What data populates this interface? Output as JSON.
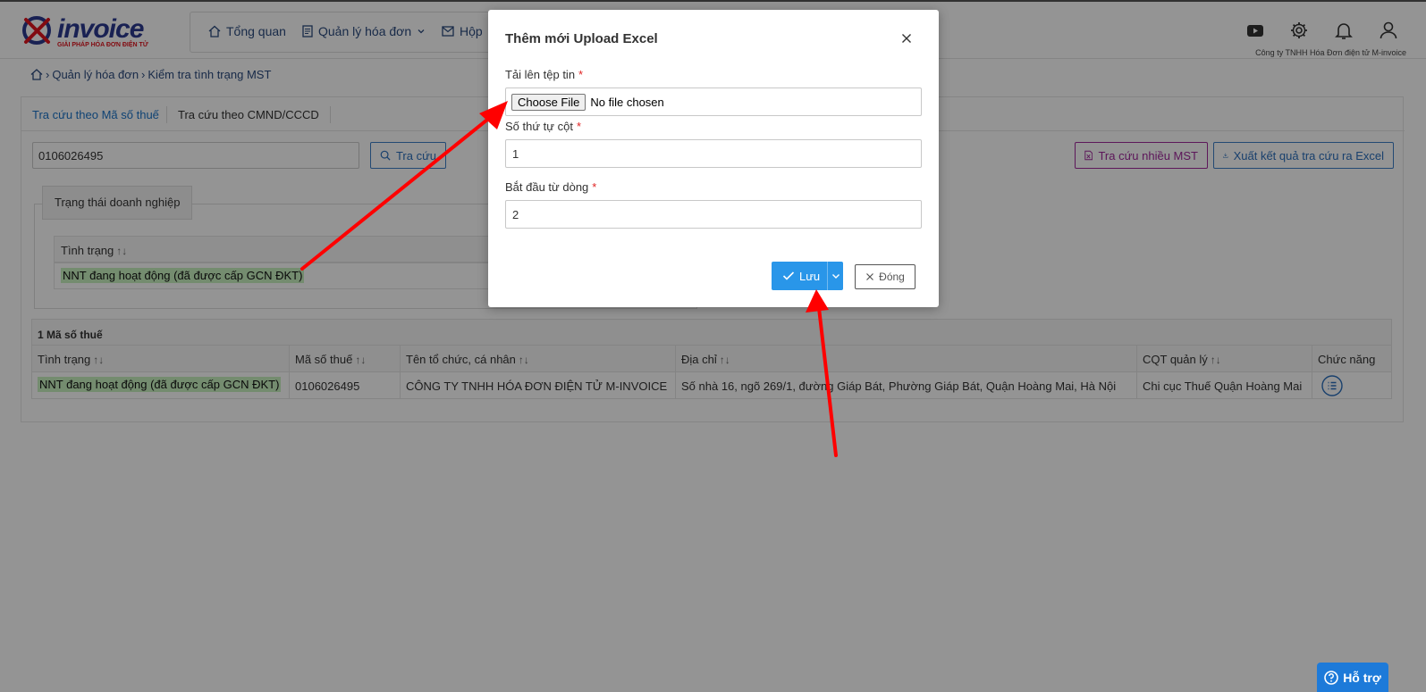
{
  "header": {
    "logo_text": "invoice",
    "logo_sub": "GIẢI PHÁP HÓA ĐƠN ĐIỆN TỬ",
    "nav": [
      {
        "label": "Tổng quan",
        "icon": "home-icon"
      },
      {
        "label": "Quản lý hóa đơn",
        "icon": "document-icon"
      },
      {
        "label": "Hộp",
        "icon": "mail-icon"
      }
    ],
    "company": "Công ty TNHH Hóa Đơn điện tử M-invoice"
  },
  "breadcrumb": {
    "items": [
      "Quản lý hóa đơn",
      "Kiểm tra tình trạng MST"
    ]
  },
  "tabs": [
    {
      "label": "Tra cứu theo Mã số thuế",
      "active": true
    },
    {
      "label": "Tra cứu theo CMND/CCCD",
      "active": false
    }
  ],
  "search": {
    "value": "0106026495",
    "button": "Tra cứu",
    "multi_button": "Tra cứu nhiều MST",
    "export_button": "Xuất kết quả tra cứu ra Excel"
  },
  "status_panel": {
    "legend": "Trạng thái doanh nghiệp",
    "header": "Tình trạng",
    "value": "NNT đang hoạt động (đã được cấp GCN ĐKT)"
  },
  "result_table": {
    "count_label": "1 Mã số thuế",
    "columns": [
      "Tình trạng",
      "Mã số thuế",
      "Tên tổ chức, cá nhân",
      "Địa chỉ",
      "CQT quản lý",
      "Chức năng"
    ],
    "rows": [
      [
        "NNT đang hoạt động (đã được cấp GCN ĐKT)",
        "0106026495",
        "CÔNG TY TNHH HÓA ĐƠN ĐIỆN TỬ M-INVOICE",
        "Số nhà 16, ngõ 269/1, đường Giáp Bát, Phường Giáp Bát, Quận Hoàng Mai, Hà Nội",
        "Chi cục Thuế Quận Hoàng Mai"
      ]
    ]
  },
  "modal": {
    "title": "Thêm mới Upload Excel",
    "file_label": "Tải lên tệp tin",
    "choose_file": "Choose File",
    "no_file": "No file chosen",
    "column_label": "Số thứ tự cột",
    "column_value": "1",
    "start_row_label": "Bắt đầu từ dòng",
    "start_row_value": "2",
    "save_label": "Lưu",
    "close_label": "Đóng",
    "required_mark": "*"
  },
  "support": {
    "label": "Hỗ trợ"
  },
  "colors": {
    "primary": "#2996e9",
    "link": "#1a73c8",
    "highlight": "#c8f1c0",
    "required": "#e02424",
    "annotation_arrow": "#ff0000",
    "purple_button": "#a0299c"
  }
}
